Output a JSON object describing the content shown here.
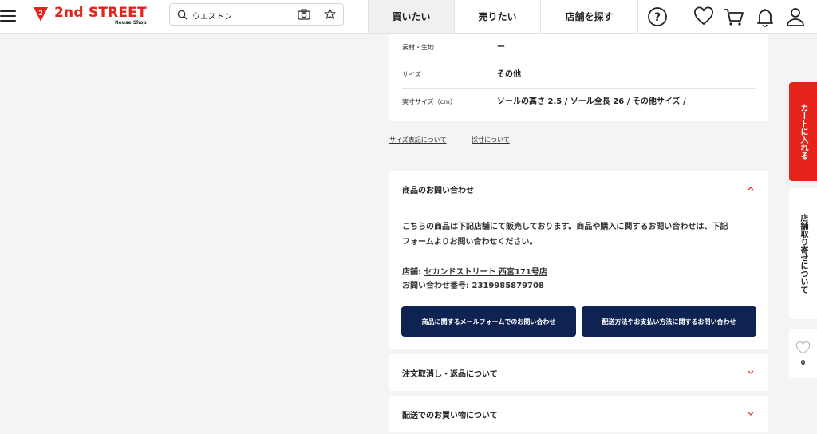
{
  "header": {
    "logo_text": "2nd STREET",
    "logo_sub": "Reuse Shop",
    "search_value": "ウエストン",
    "nav": [
      "買いたい",
      "売りたい",
      "店舗を探す"
    ]
  },
  "specs": [
    {
      "key": "素材・生地",
      "value": "ー"
    },
    {
      "key": "サイズ",
      "value": "その他"
    },
    {
      "key": "実寸サイズ（cm）",
      "value": "ソールの高さ 2.5 / ソール全長 26 / その他サイズ /"
    }
  ],
  "links": {
    "size_notation": "サイズ表記について",
    "measure": "採寸について"
  },
  "inquiry": {
    "title": "商品のお問い合わせ",
    "body_line1": "こちらの商品は下記店舗にて販売しております。商品や購入に関するお問い合わせは、下記",
    "body_line2": "フォームよりお問い合わせください。",
    "store_label": "店舗: ",
    "store_name": "セカンドストリート 西宮171号店",
    "inquiry_no": "お問い合わせ番号: 2319985879708",
    "btn_mail": "商品に関するメールフォームでのお問い合わせ",
    "btn_shipping": "配送方法やお支払い方法に関するお問い合わせ"
  },
  "accordions": {
    "cancel_return": "注文取消し・返品について",
    "shipping_shopping": "配送でのお買い物について"
  },
  "rail": {
    "cart": "カートに入れる",
    "store_order": "店舗取り寄せについて",
    "fav_count": "0"
  },
  "colors": {
    "brand_red": "#e5231b",
    "navy": "#0e2352"
  }
}
